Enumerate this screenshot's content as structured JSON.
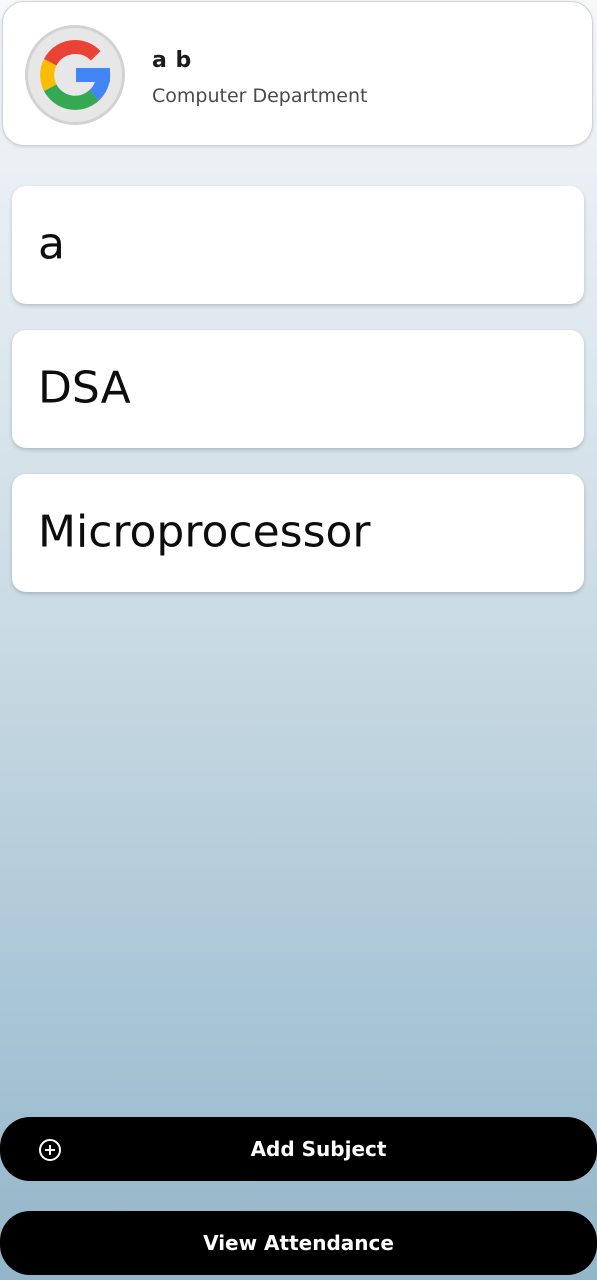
{
  "profile": {
    "name": "a b",
    "department": "Computer Department",
    "avatar_icon": "google-logo-icon"
  },
  "subjects": [
    {
      "label": "a"
    },
    {
      "label": "DSA"
    },
    {
      "label": "Microprocessor"
    }
  ],
  "actions": {
    "add_subject_label": "Add Subject",
    "add_subject_icon": "plus-circle-icon",
    "view_attendance_label": "View Attendance"
  },
  "colors": {
    "button_bg": "#000000",
    "button_text": "#ffffff",
    "card_bg": "#ffffff",
    "background_top": "#f6f8fa",
    "background_bottom": "#94b6c9",
    "google_blue": "#4285F4",
    "google_red": "#EA4335",
    "google_yellow": "#FBBC05",
    "google_green": "#34A853"
  }
}
